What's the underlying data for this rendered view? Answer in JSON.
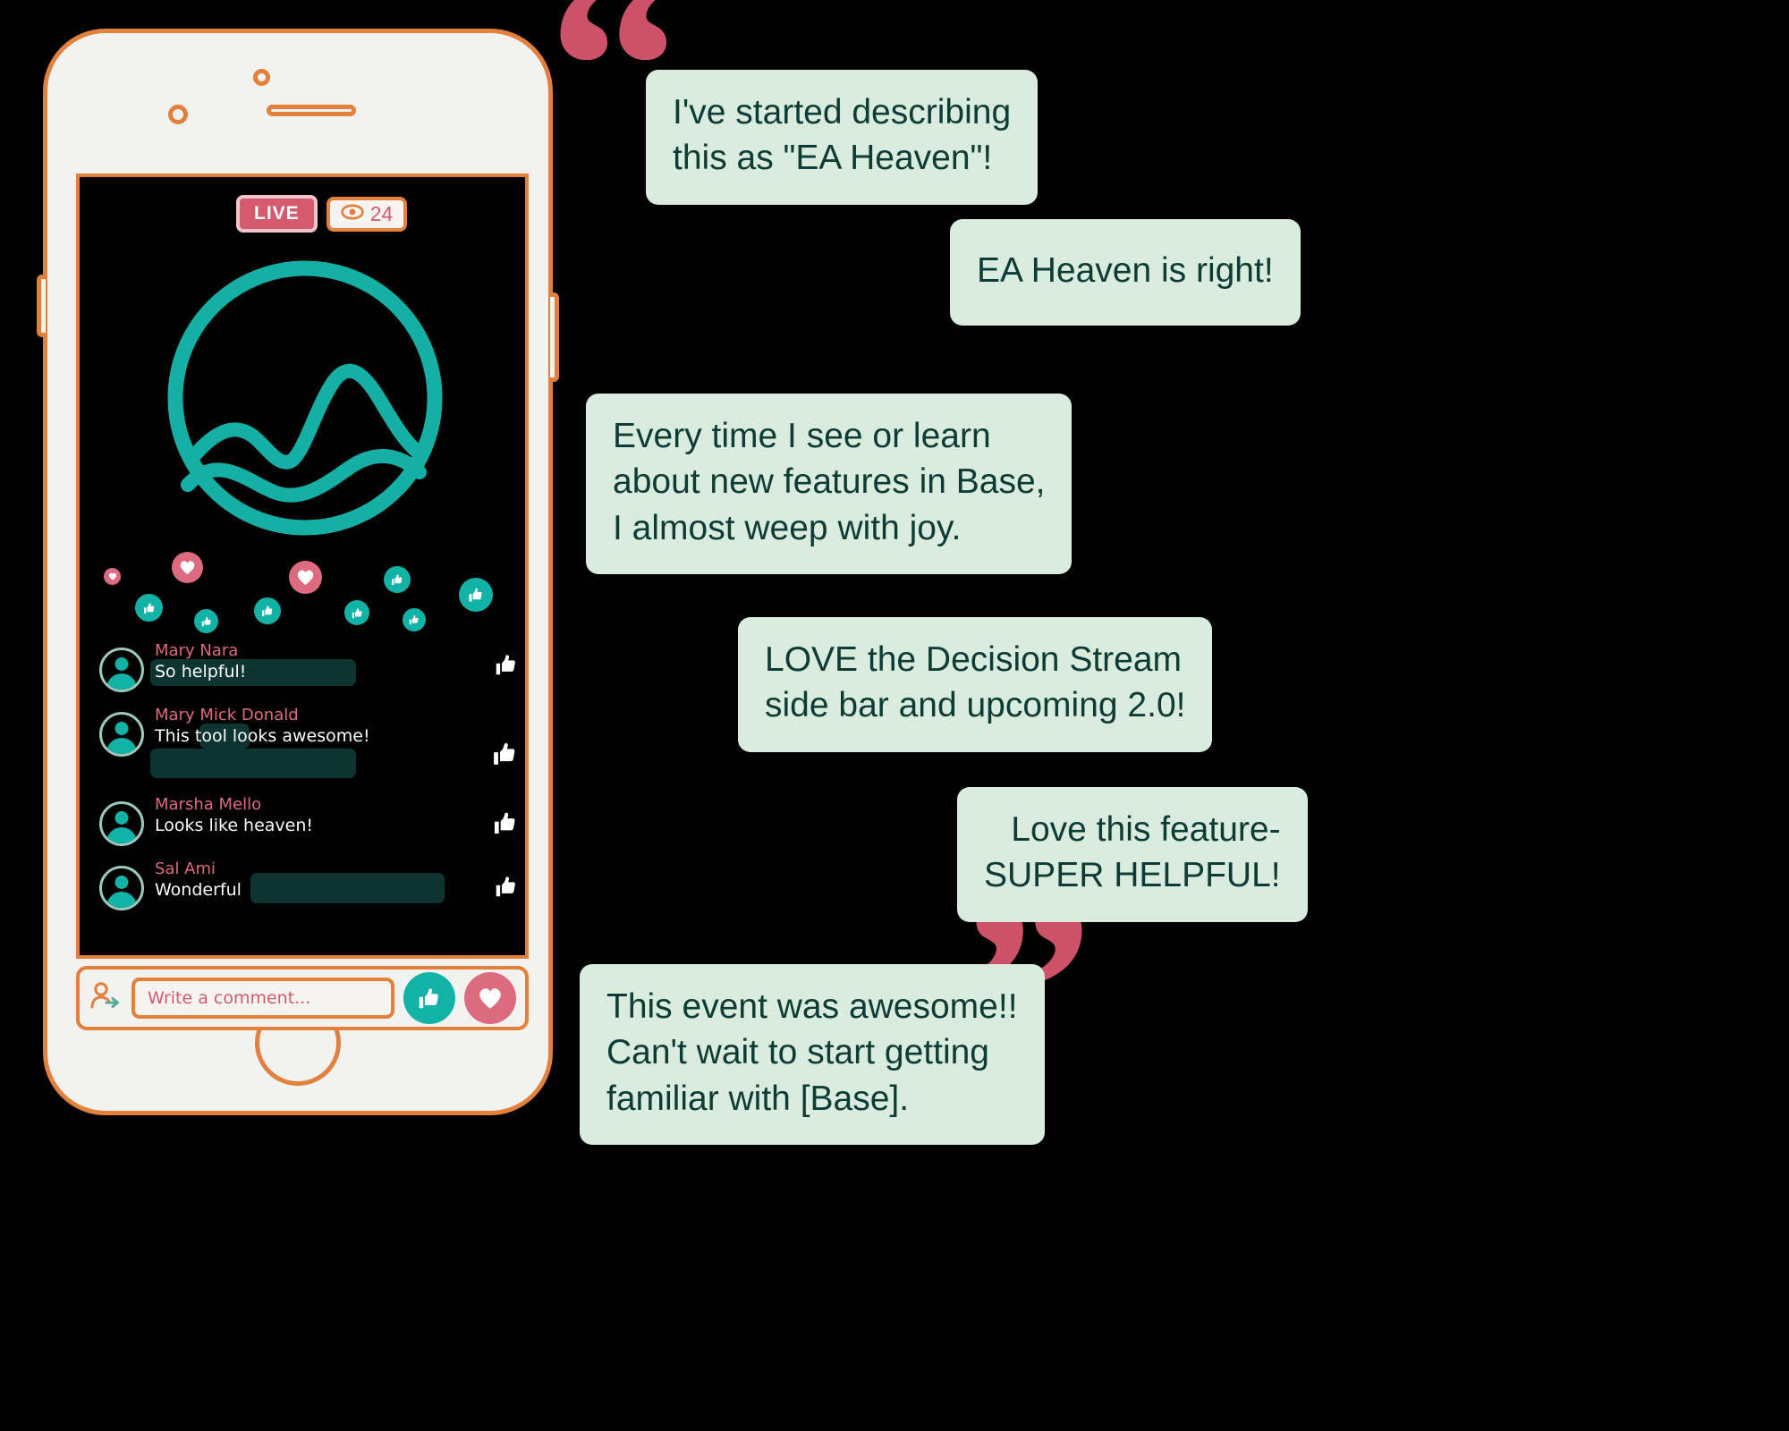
{
  "stream": {
    "live_label": "LIVE",
    "viewer_count": "24",
    "eye_icon": "eye-icon",
    "logo": "mountain-circle-logo"
  },
  "reactions": [
    {
      "type": "heart",
      "size": 18
    },
    {
      "type": "heart",
      "size": 34
    },
    {
      "type": "heart",
      "size": 36
    },
    {
      "type": "thumb",
      "size": 30
    },
    {
      "type": "thumb",
      "size": 30
    },
    {
      "type": "thumb",
      "size": 28
    },
    {
      "type": "thumb",
      "size": 26
    },
    {
      "type": "thumb",
      "size": 38
    },
    {
      "type": "thumb",
      "size": 30
    },
    {
      "type": "thumb",
      "size": 26
    }
  ],
  "comments": [
    {
      "name": "Mary Nara",
      "text": "So helpful!",
      "like_icon": "thumbs-up-icon"
    },
    {
      "name": "Mary Mick Donald",
      "text": "This tool looks awesome!",
      "like_icon": "thumbs-up-icon"
    },
    {
      "name": "Marsha Mello",
      "text": "Looks like heaven!",
      "like_icon": "thumbs-up-icon"
    },
    {
      "name": "Sal Ami",
      "text": "Wonderful",
      "like_icon": "thumbs-up-icon"
    }
  ],
  "composer": {
    "avatar_icon": "user-add-icon",
    "placeholder": "Write a comment...",
    "like_button_icon": "thumbs-up-icon",
    "heart_button_icon": "heart-icon"
  },
  "quotes": {
    "open_mark": "“",
    "close_mark": "”",
    "items": [
      {
        "id": "q1",
        "lines": [
          "I've started describing",
          "this as \"EA Heaven\"!"
        ]
      },
      {
        "id": "q2",
        "lines": [
          "EA Heaven is right!"
        ]
      },
      {
        "id": "q3",
        "lines": [
          "Every time I see or learn",
          "about new features in Base,",
          "I almost weep with joy."
        ]
      },
      {
        "id": "q4",
        "lines": [
          "LOVE the Decision Stream",
          "side bar and upcoming 2.0!"
        ]
      },
      {
        "id": "q5",
        "lines": [
          "Love this feature-",
          "SUPER HELPFUL!"
        ]
      },
      {
        "id": "q6",
        "lines": [
          "This event was awesome!!",
          "Can't wait to start getting",
          "familiar with [Base]."
        ]
      }
    ]
  },
  "colors": {
    "background": "#000000",
    "phone_outline": "#e2803c",
    "phone_body": "#f2f2f0",
    "teal": "#12b2a6",
    "pink": "#dd6b7f",
    "quote_bubble_bg": "#d9ecdd",
    "quote_text": "#0d3b36",
    "comment_bubble": "#0c3532",
    "quote_mark": "#cd5169"
  }
}
